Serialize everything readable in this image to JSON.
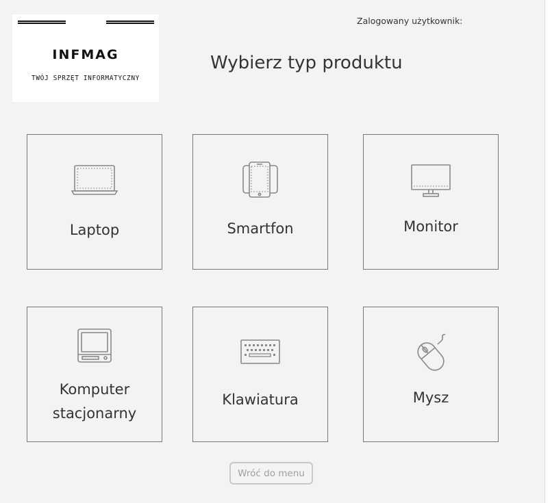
{
  "logo": {
    "brand": "INFMAG",
    "tagline": "TWÓJ SPRZĘT INFORMATYCZNY"
  },
  "header": {
    "user_label": "Zalogowany użytkownik:",
    "title": "Wybierz typ produktu"
  },
  "products": [
    {
      "label": "Laptop",
      "icon": "laptop-icon"
    },
    {
      "label": "Smartfon",
      "icon": "smartphone-icon"
    },
    {
      "label": "Monitor",
      "icon": "monitor-icon"
    },
    {
      "label_line1": "Komputer",
      "label_line2": "stacjonarny",
      "icon": "desktop-computer-icon"
    },
    {
      "label": "Klawiatura",
      "icon": "keyboard-icon"
    },
    {
      "label": "Mysz",
      "icon": "mouse-icon"
    }
  ],
  "back_button": {
    "label": "Wróć do menu"
  },
  "colors": {
    "background": "#f3f3f3",
    "card_border": "#777777",
    "icon_stroke": "#888888",
    "button_border": "#c9c9c9",
    "button_text": "#a0a0a0"
  }
}
